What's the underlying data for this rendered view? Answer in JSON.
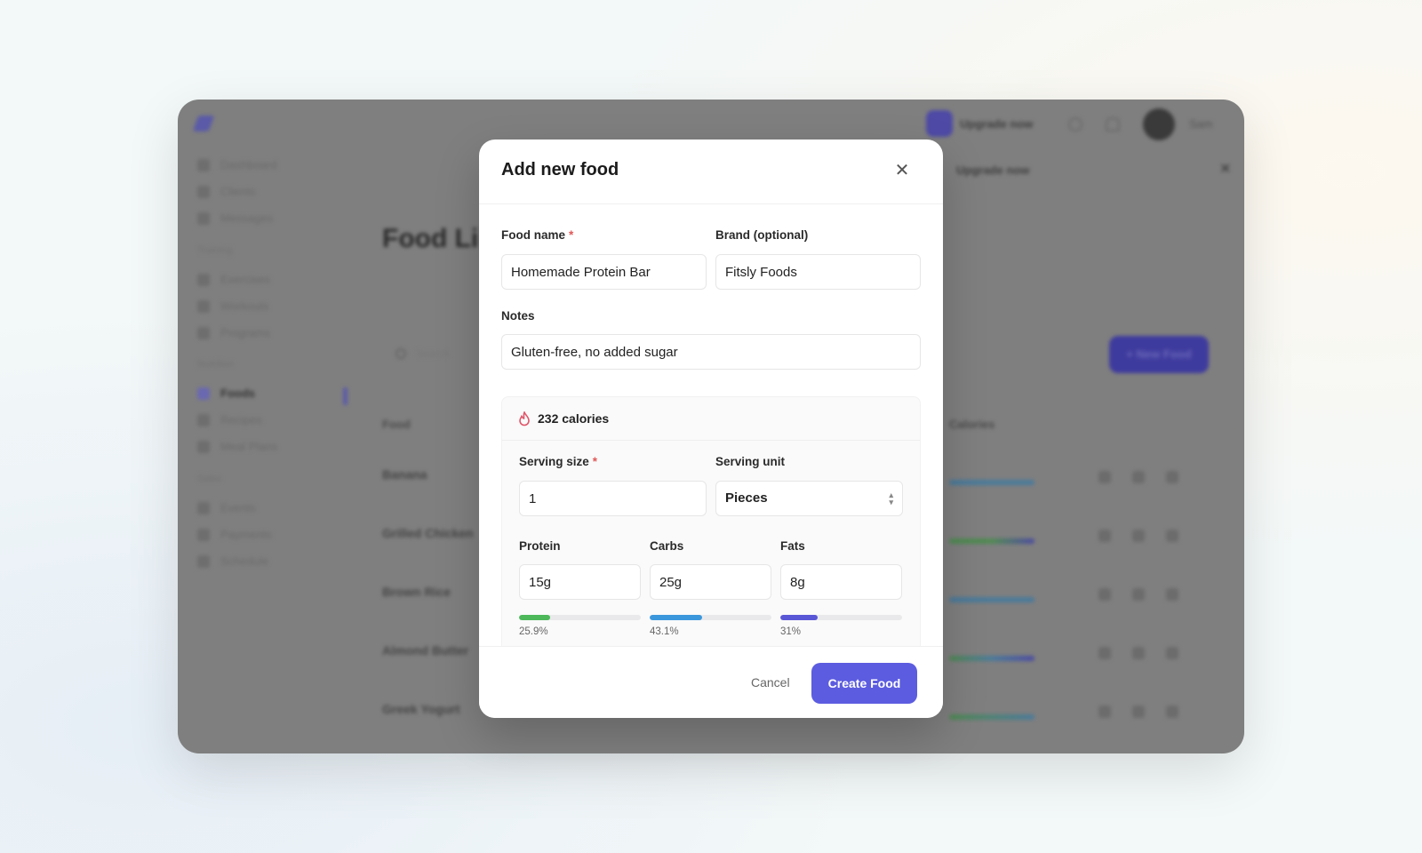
{
  "background_app": {
    "sidebar": {
      "items_top": [
        "Dashboard",
        "Clients",
        "Messages"
      ],
      "section_training": "Training",
      "items_training": [
        "Exercises",
        "Workouts",
        "Programs"
      ],
      "section_nutrition": "Nutrition",
      "items_nutrition": [
        "Foods",
        "Recipes",
        "Meal Plans"
      ],
      "section_sales": "Sales",
      "items_sales": [
        "Events",
        "Payments",
        "Schedule"
      ],
      "active_item": "Foods"
    },
    "topbar": {
      "upgrade_label": "Upgrade now",
      "user_name": "Sam"
    },
    "banner_label": "Upgrade now",
    "page_title": "Food Li",
    "search_placeholder": "Search",
    "new_food_label": "+ New Food",
    "table": {
      "headers": [
        "Food",
        "Calories"
      ],
      "rows": [
        "Banana",
        "Grilled Chicken",
        "Brown Rice",
        "Almond Butter",
        "Greek Yogurt"
      ]
    }
  },
  "modal": {
    "title": "Add new food",
    "close_icon": "close-icon",
    "food_name": {
      "label": "Food name",
      "required": "*",
      "value": "Homemade Protein Bar"
    },
    "brand": {
      "label": "Brand (optional)",
      "value": "Fitsly Foods"
    },
    "notes": {
      "label": "Notes",
      "value": "Gluten-free, no added sugar"
    },
    "calories": {
      "icon": "flame-icon",
      "label": "232 calories",
      "color": "#e0566a"
    },
    "serving_size": {
      "label": "Serving size",
      "required": "*",
      "value": "1"
    },
    "serving_unit": {
      "label": "Serving unit",
      "value": "Pieces"
    },
    "macros": [
      {
        "label": "Protein",
        "value": "15g",
        "percent": 25.9,
        "percent_label": "25.9%",
        "color": "#4cb85a"
      },
      {
        "label": "Carbs",
        "value": "25g",
        "percent": 43.1,
        "percent_label": "43.1%",
        "color": "#3b97dc"
      },
      {
        "label": "Fats",
        "value": "8g",
        "percent": 31,
        "percent_label": "31%",
        "color": "#5a57d6"
      }
    ],
    "cancel_label": "Cancel",
    "create_label": "Create Food",
    "accent": "#5c5ce0"
  }
}
